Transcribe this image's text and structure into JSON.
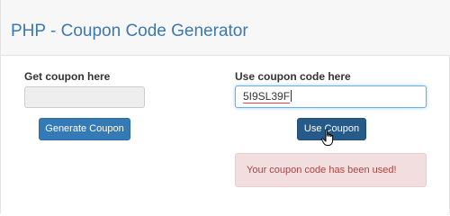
{
  "page": {
    "title": "PHP - Coupon Code Generator"
  },
  "left_panel": {
    "label": "Get coupon here",
    "input_value": "",
    "button_label": "Generate Coupon"
  },
  "right_panel": {
    "label": "Use coupon code here",
    "input_value": "5I9SL39F",
    "button_label": "Use Coupon",
    "alert_text": "Your coupon code has been used!"
  },
  "colors": {
    "title": "#3b78b2",
    "primary_button": "#337ab7",
    "active_button": "#265a88",
    "alert_bg": "#f2dede",
    "alert_text": "#a94442"
  },
  "icons": {
    "cursor": "hand-pointer-icon"
  }
}
